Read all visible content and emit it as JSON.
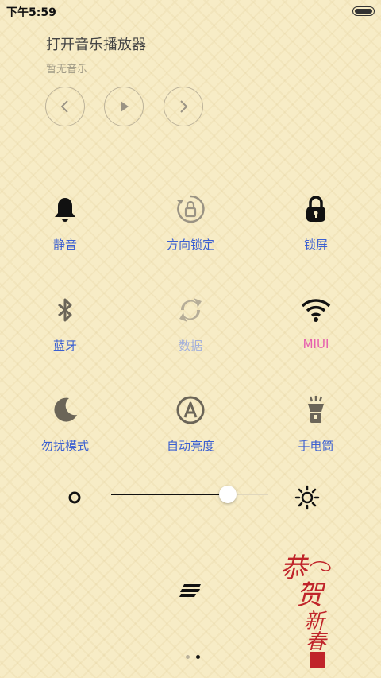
{
  "status": {
    "time": "下午5:59"
  },
  "music": {
    "title": "打开音乐播放器",
    "subtitle": "暂无音乐"
  },
  "toggles": [
    {
      "label": "静音",
      "icon": "bell-icon",
      "active": true,
      "color": "#3b5fd1"
    },
    {
      "label": "方向锁定",
      "icon": "rotation-lock-icon",
      "active": false,
      "color": "#3b5fd1"
    },
    {
      "label": "锁屏",
      "icon": "lock-icon",
      "active": true,
      "color": "#3b5fd1"
    },
    {
      "label": "蓝牙",
      "icon": "bluetooth-icon",
      "active": false,
      "color": "#3b5fd1"
    },
    {
      "label": "数据",
      "icon": "data-sync-icon",
      "active": false,
      "color": "#a3b0db"
    },
    {
      "label": "MIUI",
      "icon": "wifi-icon",
      "active": true,
      "color": "#e65fae"
    },
    {
      "label": "勿扰模式",
      "icon": "moon-icon",
      "active": false,
      "color": "#3b5fd1"
    },
    {
      "label": "自动亮度",
      "icon": "auto-brightness-icon",
      "active": false,
      "color": "#3b5fd1"
    },
    {
      "label": "手电筒",
      "icon": "flashlight-icon",
      "active": false,
      "color": "#3b5fd1"
    }
  ],
  "brightness": {
    "level": 0.74
  },
  "pages": {
    "count": 2,
    "current": 2
  },
  "decoration": {
    "text": "恭贺新春",
    "color": "#c0242a"
  }
}
